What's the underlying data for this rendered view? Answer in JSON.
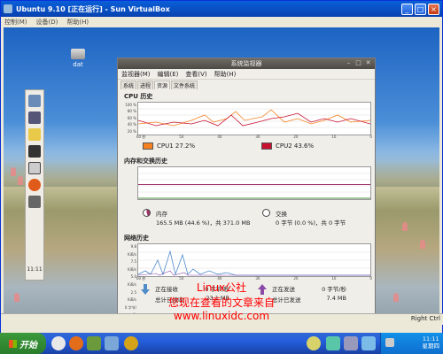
{
  "vbox": {
    "title": "Ubuntu 9.10 [正在运行] - Sun VirtualBox",
    "menu": [
      "控制(M)",
      "设备(D)",
      "帮助(H)"
    ],
    "status_right": "Right Ctrl"
  },
  "guest": {
    "desktop_icon_label": "dat",
    "clock": "11:11"
  },
  "sysmon": {
    "title": "系统监视器",
    "menu": [
      "监视器(M)",
      "编辑(E)",
      "查看(V)",
      "帮助(H)"
    ],
    "tabs": [
      "系统",
      "进程",
      "资源",
      "文件系统"
    ],
    "cpu_title": "CPU 历史",
    "mem_title": "内存和交换历史",
    "net_title": "网络历史",
    "percent_ticks": [
      "100 %",
      "80 %",
      "60 %",
      "40 %",
      "20 %",
      "0 %"
    ],
    "cpu_time_ticks": [
      "60 秒",
      "50",
      "40",
      "30",
      "20",
      "10",
      "0"
    ],
    "net_ticks": [
      "9.8 KiB/s",
      "7.5 KiB/s",
      "5.0 KiB/s",
      "2.5 KiB/s",
      "0 字节/秒"
    ],
    "cpu1_label": "CPU1 27.2%",
    "cpu2_label": "CPU2 43.6%",
    "cpu1_color": "#f58220",
    "cpu2_color": "#c8102e",
    "mem_label": "内存",
    "mem_value": "165.5 MB (44.6 %)，共 371.0 MB",
    "swap_label": "交换",
    "swap_value": "0 字节 (0.0 %)，共 0 字节",
    "recv_label": "正在接收",
    "recv_rate": "0 字节/秒",
    "recv_total_label": "总计已接收",
    "recv_total": "23.1 MB",
    "send_label": "正在发送",
    "send_rate": "0 字节/秒",
    "send_total_label": "总计已发送",
    "send_total": "7.4 MB"
  },
  "overlay": {
    "line1": "Linux公社",
    "line2": "您现在查看的文章来自",
    "line3": "www.linuxidc.com"
  },
  "taskbar": {
    "start_label": "开始",
    "time": "11:11",
    "day": "星期四"
  }
}
